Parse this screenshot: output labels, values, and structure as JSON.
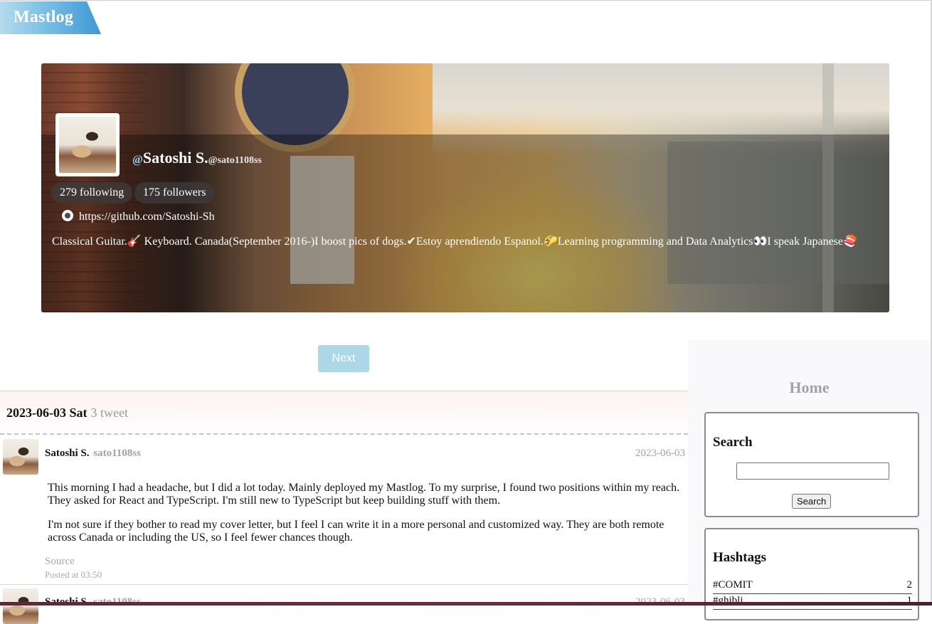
{
  "app": {
    "logo": "Mastlog"
  },
  "profile": {
    "at_icon": "@",
    "display_name": "Satoshi S.",
    "handle": "@sato1108ss",
    "following": "279 following",
    "followers": "175 followers",
    "github_icon": "github-icon",
    "github_url": "https://github.com/Satoshi-Sh",
    "bio": "Classical Guitar.🎸 Keyboard. Canada(September 2016-)I boost pics of dogs.✔Estoy aprendiendo Espanol.🌮Learning programming and Data Analytics👀I speak Japanese🍣"
  },
  "pagination": {
    "next_label": "Next"
  },
  "feed": {
    "day": {
      "date": "2023-06-03 Sat",
      "count": "3 tweet"
    },
    "posts": [
      {
        "name": "Satoshi S.",
        "username": "sato1108ss",
        "date": "2023-06-03",
        "paragraphs": [
          "This morning I had a headache, but I did a lot today. Mainly deployed my Mastlog. To my surprise, I found two positions within my reach. They asked for React and TypeScript. I'm still new to TypeScript but keep building stuff with them.",
          "I'm not sure if they bother to read my cover letter, but I feel I can write it in a more personal and customized way. They are both remote across Canada or including the US, so I feel fewer chances though."
        ],
        "source_label": "Source",
        "posted_at": "Posted at 03:50"
      },
      {
        "name": "Satoshi S.",
        "username": "sato1108ss",
        "date": "2023-06-03"
      }
    ]
  },
  "sidebar": {
    "home_title": "Home",
    "search": {
      "title": "Search",
      "input_value": "",
      "button_label": "Search"
    },
    "hashtags": {
      "title": "Hashtags",
      "items": [
        {
          "tag": "#COMIT",
          "count": "2"
        },
        {
          "tag": "#ghibli",
          "count": "1"
        }
      ]
    }
  },
  "colors": {
    "logo_gradient_start": "#b4dbee",
    "logo_gradient_end": "#3d97d6",
    "next_button": "#acd7e6",
    "username_gray": "#a9a0a0"
  }
}
